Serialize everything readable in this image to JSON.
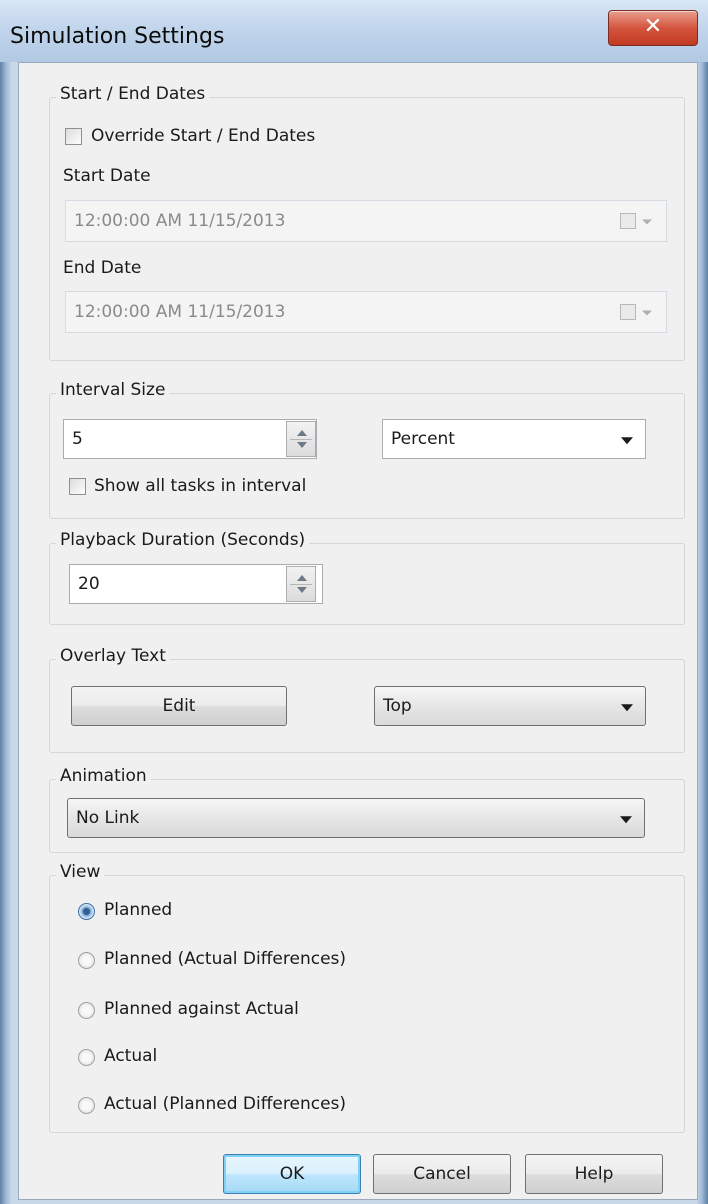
{
  "window": {
    "title": "Simulation Settings",
    "close_glyph": "✕"
  },
  "start_end": {
    "group_label": "Start / End Dates",
    "override_label": "Override Start / End Dates",
    "override_checked": false,
    "start_label": "Start Date",
    "start_value": "12:00:00 AM 11/15/2013",
    "end_label": "End Date",
    "end_value": "12:00:00 AM 11/15/2013",
    "calendar_icon": "calendar-icon"
  },
  "interval": {
    "group_label": "Interval Size",
    "value": "5",
    "unit": "Percent",
    "show_all_label": "Show all tasks in interval",
    "show_all_checked": false
  },
  "playback": {
    "group_label": "Playback Duration (Seconds)",
    "value": "20"
  },
  "overlay": {
    "group_label": "Overlay Text",
    "edit_label": "Edit",
    "position": "Top"
  },
  "animation": {
    "group_label": "Animation",
    "value": "No Link"
  },
  "view": {
    "group_label": "View",
    "options": [
      {
        "label": "Planned",
        "checked": true
      },
      {
        "label": "Planned (Actual Differences)",
        "checked": false
      },
      {
        "label": "Planned against Actual",
        "checked": false
      },
      {
        "label": "Actual",
        "checked": false
      },
      {
        "label": "Actual (Planned Differences)",
        "checked": false
      }
    ]
  },
  "buttons": {
    "ok": "OK",
    "cancel": "Cancel",
    "help": "Help"
  },
  "colors": {
    "titlebar": "#c1d5ec",
    "client": "#f0f0f0",
    "close": "#c23a22",
    "default_button": "#3c7fb1"
  }
}
